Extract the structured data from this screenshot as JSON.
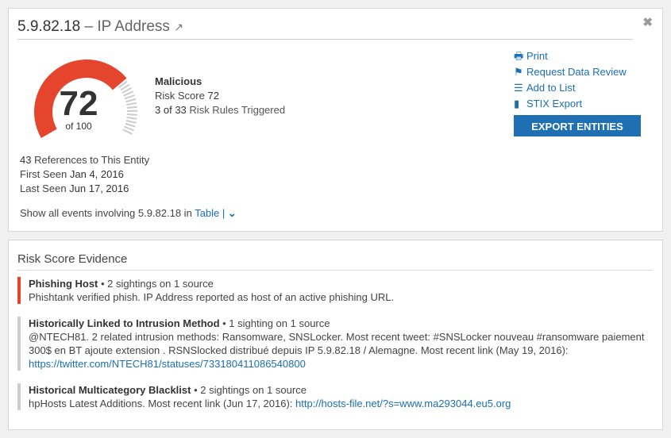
{
  "header": {
    "ip": "5.9.82.18",
    "type": "IP Address",
    "close_icon": "close-icon",
    "external_icon": "external-link-icon"
  },
  "gauge": {
    "score": "72",
    "of": "of 100",
    "value": 72,
    "max": 100,
    "color": "#e5452c"
  },
  "summary": {
    "verdict": "Malicious",
    "risk_label": "Risk Score",
    "risk_value": "72",
    "rules_count": "3",
    "rules_of": "of",
    "rules_total": "33",
    "rules_label": "Risk Rules Triggered"
  },
  "meta": {
    "refs_count": "43",
    "refs_label": "References to This Entity",
    "first_label": "First Seen",
    "first_value": "Jan 4, 2016",
    "last_label": "Last Seen",
    "last_value": "Jun 17, 2016"
  },
  "show_all": {
    "prefix": "Show all events involving 5.9.82.18 in",
    "link": "Table",
    "sep": "|"
  },
  "actions": [
    {
      "icon": "print-icon",
      "label": "Print"
    },
    {
      "icon": "flag-icon",
      "label": "Request Data Review"
    },
    {
      "icon": "list-icon",
      "label": "Add to List"
    },
    {
      "icon": "file-icon",
      "label": "STIX Export"
    }
  ],
  "export_button": "EXPORT ENTITIES",
  "evidence": {
    "title": "Risk Score Evidence",
    "items": [
      {
        "rule": "Phishing Host",
        "sightings": " • 2 sightings on 1 source",
        "color": "#e5452c",
        "text": "Phishtank verified phish. IP Address reported as host of an active phishing URL.",
        "link": ""
      },
      {
        "rule": "Historically Linked to Intrusion Method",
        "sightings": " • 1 sighting on 1 source",
        "color": "#cccccc",
        "text": "@NTECH81. 2 related intrusion methods: Ransomware, SNSLocker. Most recent tweet: #SNSLocker nouveau #ransomware paiement 300$ en BT ajoute extension . RSNSlocked distribué depuis IP 5.9.82.18 / Alemagne. Most recent link (May 19, 2016):",
        "link": "https://twitter.com/NTECH81/statuses/733180411086540800"
      },
      {
        "rule": "Historical Multicategory Blacklist",
        "sightings": " • 2 sightings on 1 source",
        "color": "#cccccc",
        "text": "hpHosts Latest Additions. Most recent link (Jun 17, 2016):",
        "link": "http://hosts-file.net/?s=www.ma293044.eu5.org"
      }
    ]
  }
}
